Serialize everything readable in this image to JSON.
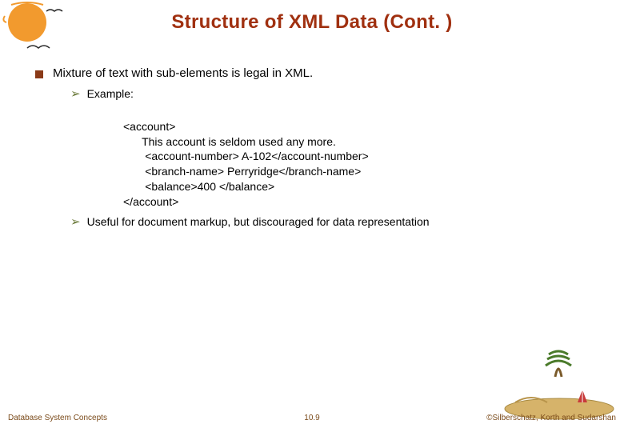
{
  "title": "Structure of XML Data (Cont. )",
  "body": {
    "main_point": "Mixture of text with sub-elements is legal in XML.",
    "sub_points": {
      "example_label": "Example:",
      "code_lines": [
        "<account>",
        "      This account is seldom used any more.",
        "       <account-number> A-102</account-number>",
        "       <branch-name> Perryridge</branch-name>",
        "       <balance>400 </balance>",
        "</account>"
      ],
      "note": "Useful for document markup, but discouraged for data representation"
    }
  },
  "footer": {
    "left": "Database System Concepts",
    "center": "10.9",
    "right": "©Silberschatz, Korth and Sudarshan"
  }
}
